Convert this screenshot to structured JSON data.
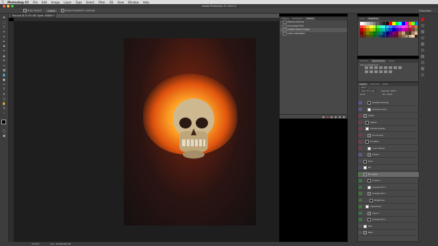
{
  "menubar": {
    "apple": "",
    "app_name": "Photoshop CC",
    "items": [
      "File",
      "Edit",
      "Image",
      "Layer",
      "Type",
      "Select",
      "Filter",
      "3D",
      "View",
      "Window",
      "Help"
    ]
  },
  "window": {
    "title": "Adobe Photoshop CC 2015.5"
  },
  "options_bar": {
    "auto_select": "Auto-Select:",
    "auto_select_target": "Layer",
    "show_transform": "Show Transform Controls",
    "workspace": "Essentials"
  },
  "document": {
    "tab_label": "Test.psd @ 33.3% (BC Lights, RGB/8) *",
    "zoom": "33.33%",
    "doc_info": "Doc: 18.9M/366.2M"
  },
  "actions_panel": {
    "tabs": [
      "History",
      "Histogram",
      "Actions"
    ],
    "active_tab": "Actions",
    "rows": [
      {
        "label": "Default Actions",
        "selected": false
      },
      {
        "label": "Enchanted Fire",
        "selected": false
      },
      {
        "label": "Create Flame Image",
        "selected": true
      },
      {
        "label": "color evaluation",
        "selected": false
      }
    ]
  },
  "swatches_panel": {
    "tabs": [
      "Color",
      "Swatches"
    ],
    "active_tab": "Swatches"
  },
  "libraries_panel": {
    "tabs": [
      "Libraries",
      "Adjustments",
      "Styles"
    ],
    "active_tab": "Adjustments",
    "add_label": "Add an adjustment"
  },
  "layers_panel": {
    "tabs": [
      "Layers",
      "Channels",
      "Paths"
    ],
    "active_tab": "Layers",
    "filter_label": "Kind",
    "blend_mode": "Pass Through",
    "opacity_label": "Opacity:",
    "opacity_value": "100%",
    "lock_label": "Lock:",
    "fill_label": "Fill:",
    "fill_value": "100%",
    "layers": [
      {
        "name": "Gradient Overlay",
        "vis": "#6a4fa0"
      },
      {
        "name": "Gradient Level",
        "vis": "#6a4fa0"
      },
      {
        "name": "Lights",
        "vis": "#7a3a4a"
      },
      {
        "name": "Sparks",
        "vis": "#7a3a4a"
      },
      {
        "name": "Flames Overlay",
        "vis": "#7a3a4a"
      },
      {
        "name": "Fire Flames",
        "vis": "#7a3a4a"
      },
      {
        "name": "Fire Back",
        "vis": "#7a3a4a"
      },
      {
        "name": "Inner Flames",
        "vis": "#7a3a4a"
      },
      {
        "name": "Smoke",
        "vis": "#5a5a8a"
      },
      {
        "name": "Skull",
        "vis": "#4a4a6a"
      },
      {
        "name": "BG",
        "vis": "#4a4a6a"
      },
      {
        "name": "BC Lights",
        "vis": "#3b7a3b"
      },
      {
        "name": "Curves 1",
        "vis": "#3b7a3b"
      },
      {
        "name": "Gradient Fill 3",
        "vis": "#3b7a3b"
      },
      {
        "name": "Gradient Fill 2",
        "vis": "#3b7a3b"
      },
      {
        "name": "Brightness",
        "vis": "#3b7a3b"
      },
      {
        "name": "Adjustment",
        "vis": "#3b7a3b"
      },
      {
        "name": "Layer 1",
        "vis": "#3b7a3b"
      },
      {
        "name": "Gradient Fill 1",
        "vis": "#3b7a3b"
      },
      {
        "name": "Skin",
        "vis": "#555555"
      },
      {
        "name": "Back",
        "vis": "#555555"
      }
    ],
    "selected_layer": "BC Lights"
  },
  "colors": {
    "accent_red": "#c8102e",
    "panel_bg": "#484848",
    "canvas_bg": "#1e1e1e"
  }
}
